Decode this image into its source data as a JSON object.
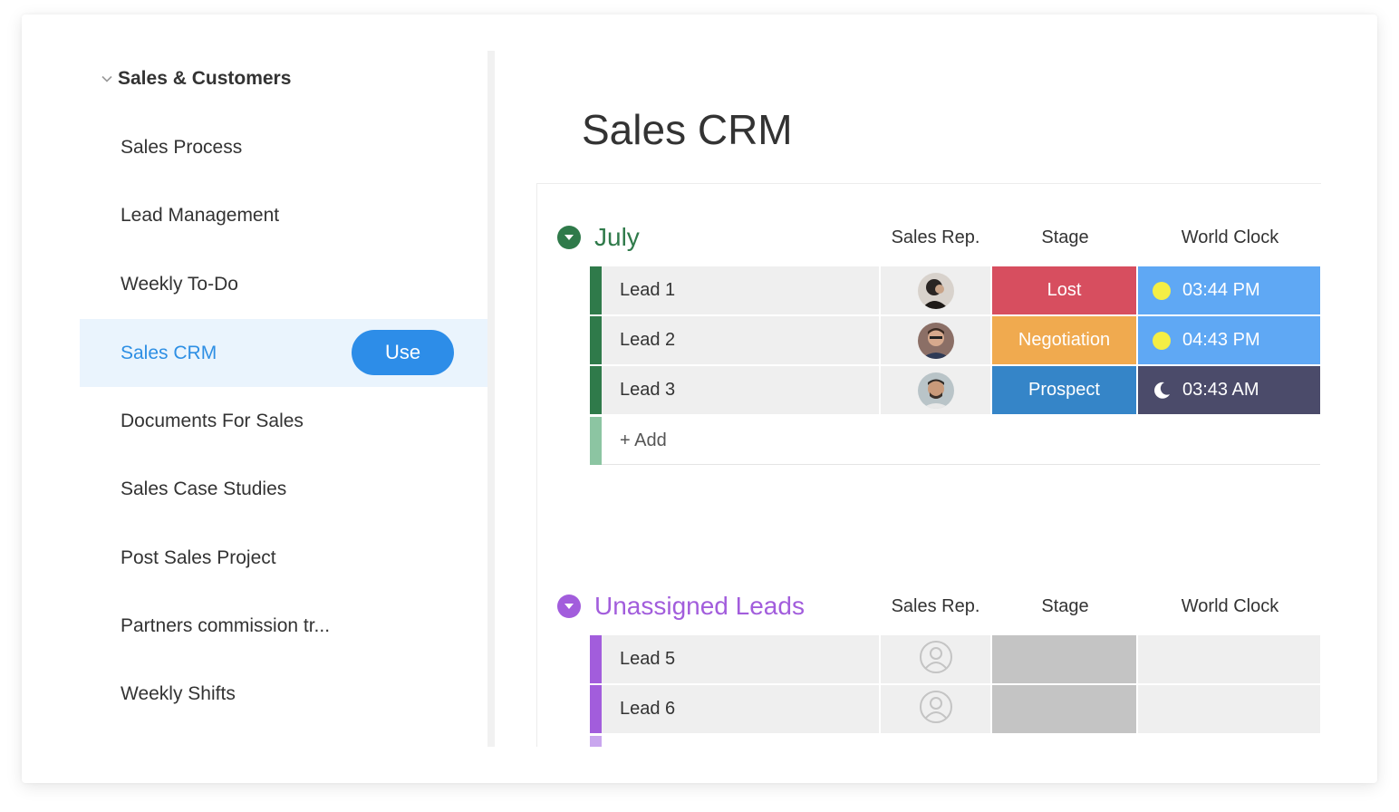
{
  "sidebar": {
    "category": "Sales & Customers",
    "items": [
      {
        "label": "Sales Process"
      },
      {
        "label": "Lead Management"
      },
      {
        "label": "Weekly To-Do"
      },
      {
        "label": "Sales CRM",
        "active": true
      },
      {
        "label": "Documents For Sales"
      },
      {
        "label": "Sales Case Studies"
      },
      {
        "label": "Post Sales Project"
      },
      {
        "label": "Partners commission tr..."
      },
      {
        "label": "Weekly Shifts"
      }
    ],
    "use_label": "Use"
  },
  "main": {
    "title": "Sales CRM",
    "columns": {
      "rep": "Sales Rep.",
      "stage": "Stage",
      "clock": "World Clock"
    },
    "groups": [
      {
        "title": "July",
        "color": "#2f7a4a",
        "rows": [
          {
            "name": "Lead 1",
            "stage": "Lost",
            "stage_color": "#d74e5f",
            "time": "03:44 PM",
            "time_icon": "sun-icon",
            "clock_color": "#5fa8f4"
          },
          {
            "name": "Lead 2",
            "stage": "Negotiation",
            "stage_color": "#f0aa4f",
            "time": "04:43 PM",
            "time_icon": "sun-icon",
            "clock_color": "#5fa8f4"
          },
          {
            "name": "Lead 3",
            "stage": "Prospect",
            "stage_color": "#3585c8",
            "time": "03:43 AM",
            "time_icon": "moon-icon",
            "clock_color": "#4b4b6a"
          }
        ],
        "add_label": "+ Add"
      },
      {
        "title": "Unassigned Leads",
        "color": "#a25ddc",
        "rows": [
          {
            "name": "Lead 5"
          },
          {
            "name": "Lead 6"
          }
        ]
      }
    ]
  },
  "colors": {
    "accent": "#2d8de8",
    "active_bg": "#eaf4fd",
    "empty_stage": "#c4c4c4",
    "sun": "#f4ee45"
  }
}
